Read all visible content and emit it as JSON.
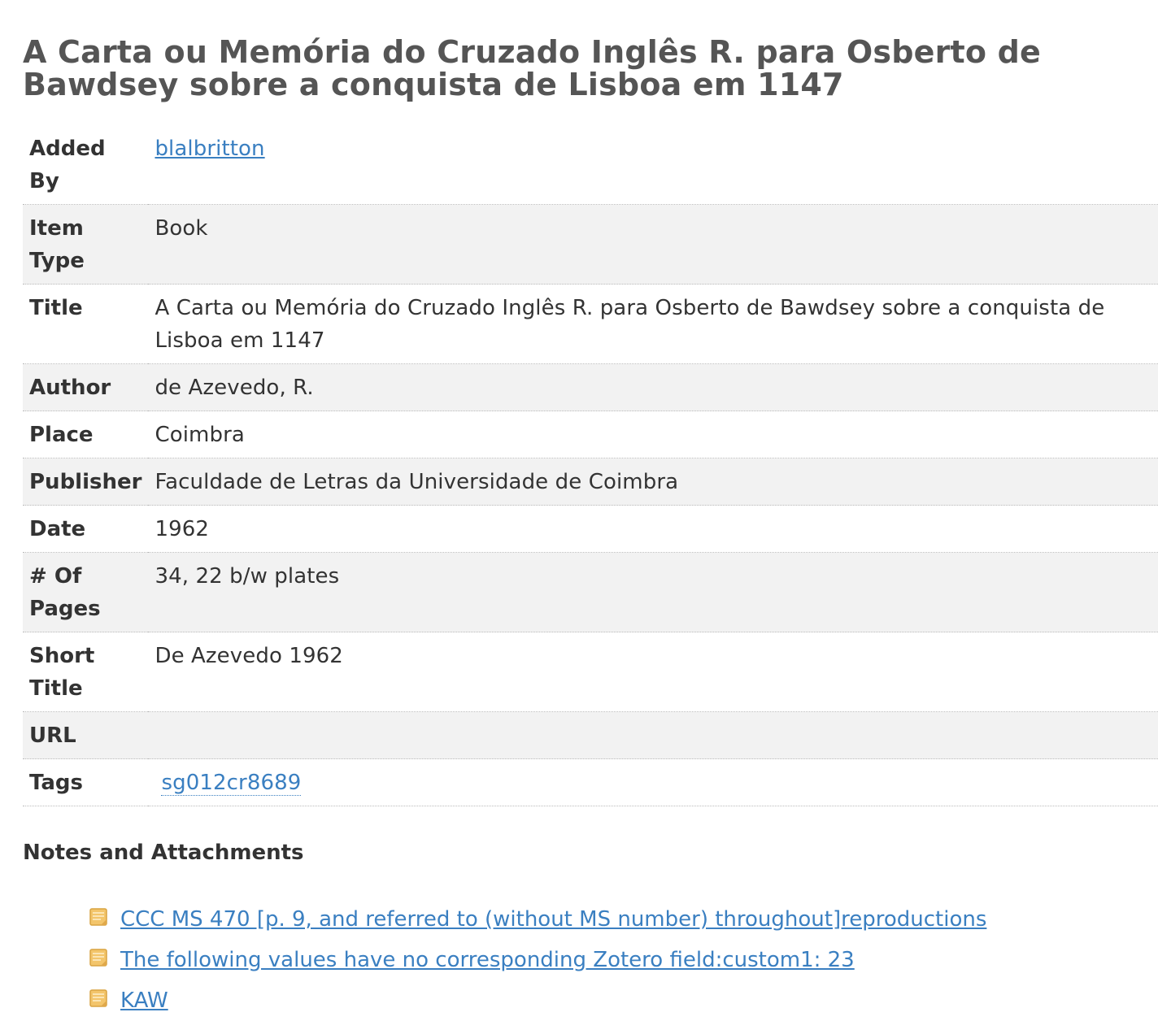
{
  "title": "A Carta ou Memória do Cruzado Inglês R. para Osberto de Bawdsey sobre a conquista de Lisboa em 1147",
  "fields": [
    {
      "label": "Added By",
      "value": "blalbritton",
      "kind": "link"
    },
    {
      "label": "Item Type",
      "value": "Book",
      "kind": "text"
    },
    {
      "label": "Title",
      "value": "A Carta ou Memória do Cruzado Inglês R. para Osberto de Bawdsey sobre a conquista de Lisboa em 1147",
      "kind": "text"
    },
    {
      "label": "Author",
      "value": "de Azevedo, R.",
      "kind": "text"
    },
    {
      "label": "Place",
      "value": "Coimbra",
      "kind": "text"
    },
    {
      "label": "Publisher",
      "value": "Faculdade de Letras da Universidade de Coimbra",
      "kind": "text"
    },
    {
      "label": "Date",
      "value": "1962",
      "kind": "text"
    },
    {
      "label": "# Of Pages",
      "value": "34, 22 b/w plates",
      "kind": "text"
    },
    {
      "label": "Short Title",
      "value": "De Azevedo 1962",
      "kind": "text"
    },
    {
      "label": "URL",
      "value": "",
      "kind": "text"
    },
    {
      "label": "Tags",
      "value": "sg012cr8689",
      "kind": "tag"
    }
  ],
  "notes": {
    "heading": "Notes and Attachments",
    "items": [
      {
        "label": "CCC MS 470 [p. 9, and referred to (without MS number) throughout]reproductions",
        "icon": "note-icon"
      },
      {
        "label": "The following values have no corresponding Zotero field:custom1: 23",
        "icon": "note-icon"
      },
      {
        "label": "KAW",
        "icon": "note-icon"
      }
    ]
  },
  "colors": {
    "link": "#3a7fc1",
    "title": "#555555",
    "row_alt": "#f2f2f2",
    "note_icon_fill": "#f3c56b",
    "note_icon_border": "#d9a441"
  }
}
